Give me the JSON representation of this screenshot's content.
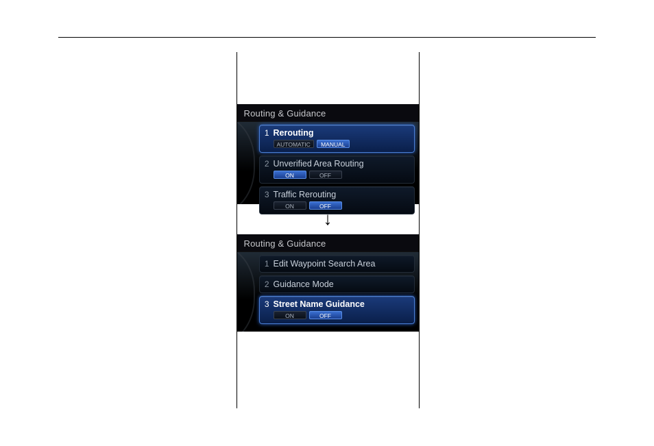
{
  "panel_upper": {
    "title": "Routing & Guidance",
    "items": [
      {
        "num": "1",
        "label": "Rerouting",
        "opt_a": "AUTOMATIC",
        "opt_b": "MANUAL",
        "active": "b",
        "selected": true
      },
      {
        "num": "2",
        "label": "Unverified Area Routing",
        "opt_a": "ON",
        "opt_b": "OFF",
        "active": "a",
        "selected": false
      },
      {
        "num": "3",
        "label": "Traffic Rerouting",
        "opt_a": "ON",
        "opt_b": "OFF",
        "active": "b",
        "selected": false
      }
    ]
  },
  "panel_lower": {
    "title": "Routing & Guidance",
    "items": [
      {
        "num": "1",
        "label": "Edit Waypoint Search Area",
        "selected": false
      },
      {
        "num": "2",
        "label": "Guidance Mode",
        "selected": false
      },
      {
        "num": "3",
        "label": "Street Name Guidance",
        "opt_a": "ON",
        "opt_b": "OFF",
        "active": "b",
        "selected": true
      }
    ]
  }
}
